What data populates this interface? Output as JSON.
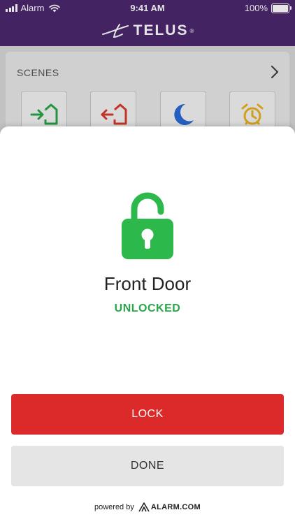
{
  "status_bar": {
    "carrier": "Alarm",
    "time": "9:41 AM",
    "battery": "100%",
    "battery_level": 1.0
  },
  "brand": {
    "name": "TELUS",
    "registered": "®",
    "color": "#4b286d"
  },
  "scenes": {
    "title": "SCENES",
    "items": [
      {
        "icon": "arrive-home-icon",
        "color": "#2aa54a"
      },
      {
        "icon": "leave-home-icon",
        "color": "#d93a2b"
      },
      {
        "icon": "moon-icon",
        "color": "#2a6ad6"
      },
      {
        "icon": "alarm-clock-icon",
        "color": "#e8b321"
      }
    ]
  },
  "lock_sheet": {
    "icon": "unlocked-padlock-icon",
    "icon_color": "#2db84c",
    "device_name": "Front Door",
    "status": "UNLOCKED",
    "status_color": "#2aa54a",
    "lock_button_label": "LOCK",
    "lock_button_color": "#dc2a2a",
    "done_button_label": "DONE",
    "done_button_color": "#e5e5e5"
  },
  "footer": {
    "powered_by": "powered by",
    "partner": "ALARM.COM"
  }
}
